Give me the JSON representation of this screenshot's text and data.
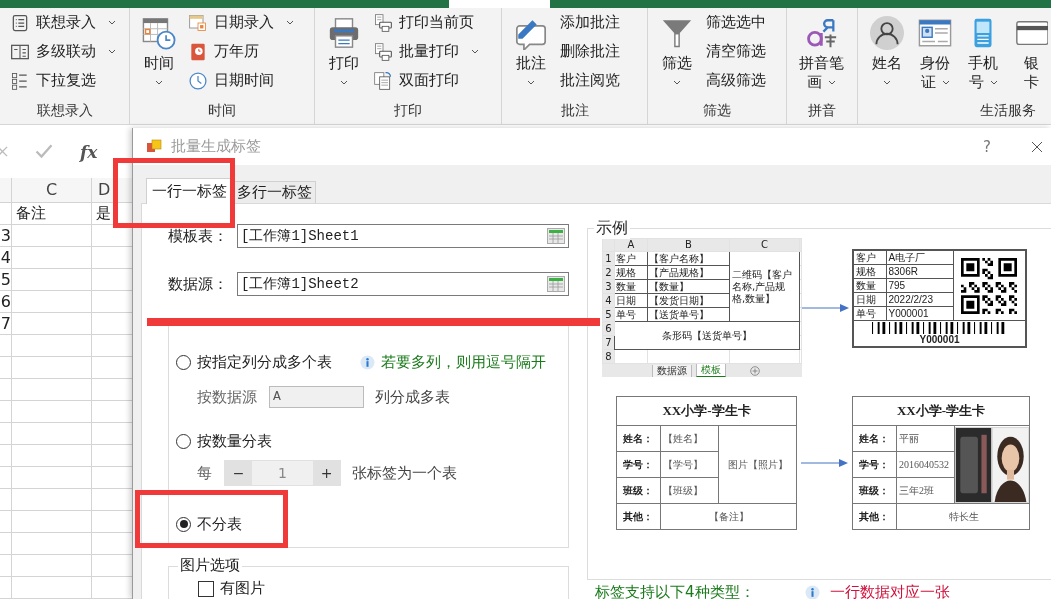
{
  "ribbon": {
    "groups": [
      {
        "label": "联想录入",
        "items": [
          {
            "kind": "small",
            "label": "联想录入",
            "dropdown": true
          },
          {
            "kind": "small",
            "label": "多级联动",
            "dropdown": true
          },
          {
            "kind": "small",
            "label": "下拉复选",
            "dropdown": false
          }
        ]
      },
      {
        "label": "时间",
        "items": [
          {
            "kind": "large",
            "lines": [
              "时间"
            ],
            "dropdown": true
          },
          {
            "kind": "small",
            "label": "日期录入",
            "dropdown": true
          },
          {
            "kind": "small",
            "label": "万年历",
            "dropdown": false
          },
          {
            "kind": "small",
            "label": "日期时间",
            "dropdown": false
          }
        ]
      },
      {
        "label": "打印",
        "items": [
          {
            "kind": "large",
            "lines": [
              "打印"
            ],
            "dropdown": true
          },
          {
            "kind": "small",
            "label": "打印当前页",
            "dropdown": false
          },
          {
            "kind": "small",
            "label": "批量打印",
            "dropdown": true
          },
          {
            "kind": "small",
            "label": "双面打印",
            "dropdown": false
          }
        ]
      },
      {
        "label": "批注",
        "items": [
          {
            "kind": "large",
            "lines": [
              "批注"
            ],
            "dropdown": true
          },
          {
            "kind": "small",
            "label": "添加批注",
            "dropdown": false
          },
          {
            "kind": "small",
            "label": "删除批注",
            "dropdown": false
          },
          {
            "kind": "small",
            "label": "批注阅览",
            "dropdown": false
          }
        ]
      },
      {
        "label": "筛选",
        "items": [
          {
            "kind": "large",
            "lines": [
              "筛选"
            ],
            "dropdown": true
          },
          {
            "kind": "small",
            "label": "筛选选中",
            "dropdown": false
          },
          {
            "kind": "small",
            "label": "清空筛选",
            "dropdown": false
          },
          {
            "kind": "small",
            "label": "高级筛选",
            "dropdown": false
          }
        ]
      },
      {
        "label": "拼音",
        "items": [
          {
            "kind": "large",
            "lines": [
              "拼音笔",
              "画"
            ],
            "dropdown": true
          }
        ]
      },
      {
        "label": "生活服务",
        "items": [
          {
            "kind": "large",
            "lines": [
              "姓名"
            ],
            "dropdown": true
          },
          {
            "kind": "large",
            "lines": [
              "身份",
              "证"
            ],
            "dropdown": true
          },
          {
            "kind": "large",
            "lines": [
              "手机",
              "号"
            ],
            "dropdown": true
          },
          {
            "kind": "large",
            "lines": [
              "银",
              "卡"
            ],
            "dropdown": false
          }
        ]
      }
    ]
  },
  "formula_bar": {
    "fx": "fx"
  },
  "sheet": {
    "columns": [
      "C",
      "D"
    ],
    "header_row": [
      "备注",
      "是"
    ],
    "row_numbers": [
      "3",
      "4",
      "5",
      "6",
      "7"
    ]
  },
  "dialog": {
    "title": "批量生成标签",
    "help": "?",
    "tabs": [
      {
        "label": "一行一标签",
        "selected": true
      },
      {
        "label": "多行一标签",
        "selected": false
      }
    ],
    "fields": [
      {
        "label": "模板表：",
        "value": "[工作簿1]Sheet1"
      },
      {
        "label": "数据源：",
        "value": "[工作簿1]Sheet2"
      }
    ],
    "split_options": [
      {
        "kind": "column",
        "label": "按指定列分成多个表",
        "selected": false,
        "hint": "若要多列，则用逗号隔开",
        "prefix": "按数据源",
        "value": "A",
        "suffix": "列分成多表",
        "disabled": true
      },
      {
        "kind": "count",
        "label": "按数量分表",
        "selected": false,
        "prefix": "每",
        "minus": "−",
        "value": "1",
        "plus": "+",
        "suffix": "张标签为一个表",
        "disabled": true
      },
      {
        "kind": "none",
        "label": "不分表",
        "selected": true
      }
    ],
    "picture_options": {
      "title": "图片选项",
      "checkbox": {
        "label": "有图片",
        "checked": false
      }
    },
    "example": {
      "title": "示例",
      "template_sheet": {
        "columns": [
          "A",
          "B",
          "C"
        ],
        "rows": [
          {
            "num": "1",
            "key": "客户",
            "value": "【客户名称】"
          },
          {
            "num": "2",
            "key": "规格",
            "value": "【产品规格】"
          },
          {
            "num": "3",
            "key": "数量",
            "value": "【数量】"
          },
          {
            "num": "4",
            "key": "日期",
            "value": "【发货日期】"
          },
          {
            "num": "5",
            "key": "单号",
            "value": "【送货单号】"
          }
        ],
        "qr_cell": "二维码【客户名称,产品规格,数量】",
        "barcode_cell": "条形码【送货单号】",
        "extra_rows": [
          "6",
          "7",
          "8"
        ],
        "sheet_tabs": [
          {
            "label": "数据源",
            "selected": false
          },
          {
            "label": "模板",
            "selected": true
          }
        ]
      },
      "label_result": {
        "rows": [
          {
            "key": "客户",
            "value": "A电子厂"
          },
          {
            "key": "规格",
            "value": "8306R"
          },
          {
            "key": "数量",
            "value": "795"
          },
          {
            "key": "日期",
            "value": "2022/2/23"
          },
          {
            "key": "单号",
            "value": "Y000001"
          }
        ],
        "barcode_text": "Y000001"
      },
      "cards": [
        {
          "title": "XX小学-学生卡",
          "rows": [
            {
              "key": "姓名：",
              "value": "【姓名】"
            },
            {
              "key": "学号：",
              "value": "【学号】"
            },
            {
              "key": "班级：",
              "value": "【班级】"
            }
          ],
          "photo": {
            "kind": "text",
            "text": "图片【照片】"
          },
          "other_key": "其他：",
          "other_value": "【备注】"
        },
        {
          "title": "XX小学-学生卡",
          "rows": [
            {
              "key": "姓名：",
              "value": "平丽"
            },
            {
              "key": "学号：",
              "value": "2016040532"
            },
            {
              "key": "班级：",
              "value": "三年2班"
            }
          ],
          "photo": {
            "kind": "picture"
          },
          "other_key": "其他：",
          "other_value": "特长生"
        }
      ]
    },
    "footer_note": "标签支持以下4种类型：",
    "footer_rule": "一行数据对应一张"
  }
}
